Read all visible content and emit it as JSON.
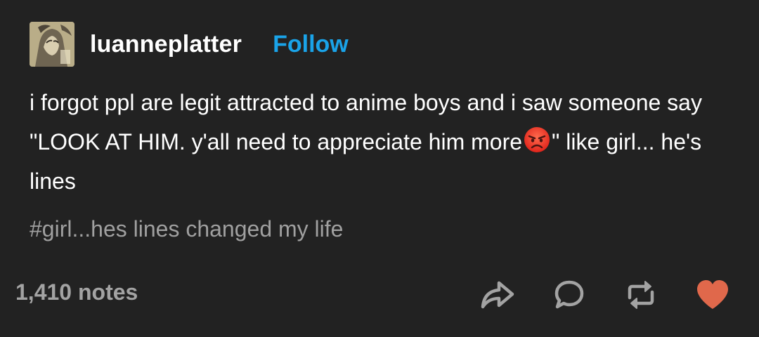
{
  "post": {
    "username": "luanneplatter",
    "follow_label": "Follow",
    "text_part1": "i forgot ppl are legit attracted to anime boys and i saw someone say \"LOOK AT HIM. y'all need to appreciate him more",
    "text_emoji": "angry-face-emoji",
    "text_part2": "\" like girl... he's lines",
    "tags": "#girl...hes lines changed my life",
    "notes": "1,410 notes"
  },
  "actions": [
    {
      "icon": "share-icon"
    },
    {
      "icon": "reply-icon"
    },
    {
      "icon": "reblog-icon"
    },
    {
      "icon": "heart-icon"
    }
  ],
  "colors": {
    "background": "#222222",
    "follow": "#1aa3e8",
    "tags": "#a0a0a0",
    "notes": "#a3a3a3",
    "icon": "#a3a3a3",
    "heart": "#e0684b"
  }
}
